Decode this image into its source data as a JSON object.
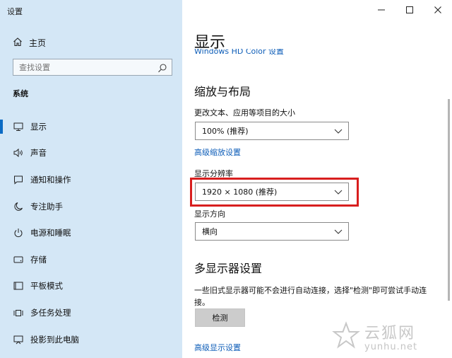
{
  "window": {
    "title": "设置",
    "controls": [
      "minimize",
      "maximize",
      "close"
    ]
  },
  "sidebar": {
    "home_label": "主页",
    "search_placeholder": "查找设置",
    "section": "系统",
    "items": [
      {
        "label": "显示",
        "icon": "monitor-icon",
        "active": true
      },
      {
        "label": "声音",
        "icon": "speaker-icon"
      },
      {
        "label": "通知和操作",
        "icon": "notification-icon"
      },
      {
        "label": "专注助手",
        "icon": "moon-icon"
      },
      {
        "label": "电源和睡眠",
        "icon": "power-icon"
      },
      {
        "label": "存储",
        "icon": "storage-icon"
      },
      {
        "label": "平板模式",
        "icon": "tablet-icon"
      },
      {
        "label": "多任务处理",
        "icon": "multitask-icon"
      },
      {
        "label": "投影到此电脑",
        "icon": "project-icon"
      }
    ]
  },
  "main": {
    "title": "显示",
    "hdr_link": "Windows HD Color 设置",
    "scale_section": {
      "heading": "缩放与布局",
      "text_size_label": "更改文本、应用等项目的大小",
      "text_size_value": "100% (推荐)",
      "advanced_scaling_link": "高级缩放设置",
      "resolution_label": "显示分辨率",
      "resolution_value": "1920 × 1080 (推荐)",
      "orientation_label": "显示方向",
      "orientation_value": "横向"
    },
    "multi_section": {
      "heading": "多显示器设置",
      "description": "一些旧式显示器可能不会进行自动连接，选择\"检测\"即可尝试手动连接。",
      "detect_button": "检测",
      "advanced_display_link": "高级显示设置"
    }
  },
  "watermark": {
    "cn": "云狐网",
    "en": "yunhu.net"
  },
  "colors": {
    "sidebar_bg": "#d4e7f6",
    "accent": "#0b6bc4",
    "link": "#0d5db8",
    "highlight": "#d81e1e"
  }
}
